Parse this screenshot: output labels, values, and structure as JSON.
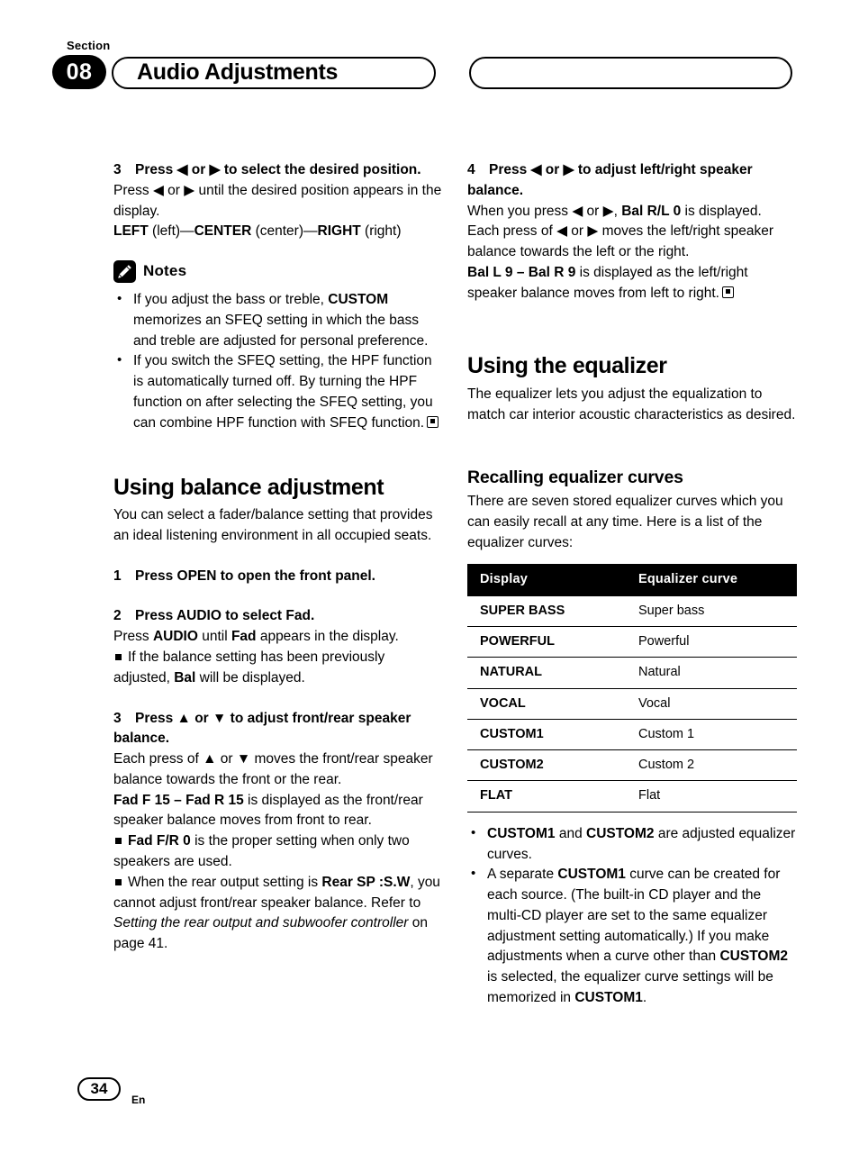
{
  "header": {
    "section_label": "Section",
    "section_number": "08",
    "title": "Audio Adjustments"
  },
  "left_column": {
    "step3": {
      "num": "3",
      "heading_pre": "Press ",
      "heading_mid": " or ",
      "heading_post": " to select the desired position.",
      "body_pre": "Press ",
      "body_mid": " or ",
      "body_post": " until the desired position appears in the display.",
      "positions_left_bold": "LEFT",
      "positions_left_plain": " (left)—",
      "positions_center_bold": "CENTER",
      "positions_center_plain": " (center)—",
      "positions_right_bold": "RIGHT",
      "positions_right_plain": " (right)"
    },
    "notes_label": "Notes",
    "notes": [
      {
        "pre": "If you adjust the bass or treble, ",
        "bold": "CUSTOM",
        "post": " memorizes an SFEQ setting in which the bass and treble are adjusted for personal preference."
      },
      {
        "pre": "If you switch the SFEQ setting, the HPF function is automatically turned off. By turning the HPF function on after selecting the SFEQ setting, you can combine HPF function with SFEQ function.",
        "bold": "",
        "post": ""
      }
    ],
    "balance_heading": "Using balance adjustment",
    "balance_intro": "You can select a fader/balance setting that provides an ideal listening environment in all occupied seats.",
    "step1": {
      "num": "1",
      "text": "Press OPEN to open the front panel."
    },
    "step2": {
      "num": "2",
      "text": "Press AUDIO to select Fad.",
      "body_pre": "Press ",
      "body_bold1": "AUDIO",
      "body_mid": " until ",
      "body_bold2": "Fad",
      "body_post": " appears in the display.",
      "note_pre": "If the balance setting has been previously adjusted, ",
      "note_bold": "Bal",
      "note_post": " will be displayed."
    },
    "step3b": {
      "num": "3",
      "heading_pre": "Press ",
      "heading_mid": " or ",
      "heading_post": " to adjust front/rear speaker balance.",
      "body_pre": "Each press of ",
      "body_mid": " or ",
      "body_post": " moves the front/rear speaker balance towards the front or the rear.",
      "range_bold": "Fad F 15 – Fad R 15",
      "range_plain": " is displayed as the front/rear speaker balance moves from front to rear.",
      "note1_bold": "Fad F/R 0",
      "note1_plain": " is the proper setting when only two speakers are used.",
      "note2_pre": "When the rear output setting is ",
      "note2_bold": "Rear SP :S.W",
      "note2_mid": ", you cannot adjust front/rear speaker balance. Refer to ",
      "note2_italic": "Setting the rear output and subwoofer controller",
      "note2_post": " on page 41."
    }
  },
  "right_column": {
    "step4": {
      "num": "4",
      "heading_pre": "Press ",
      "heading_mid": " or ",
      "heading_post": " to adjust left/right speaker balance.",
      "body_pre": "When you press ",
      "body_mid": " or ",
      "body_mid2": ", ",
      "body_bold": "Bal R/L 0",
      "body_post": " is displayed. Each press of ",
      "body_post2": " or ",
      "body_post3": " moves the left/right speaker balance towards the left or the right.",
      "range_bold": "Bal L 9 – Bal R 9",
      "range_plain": " is displayed as the left/right speaker balance moves from left to right."
    },
    "equalizer_heading": "Using the equalizer",
    "equalizer_intro": "The equalizer lets you adjust the equalization to match car interior acoustic characteristics as desired.",
    "recall_heading": "Recalling equalizer curves",
    "recall_intro": "There are seven stored equalizer curves which you can easily recall at any time. Here is a list of the equalizer curves:",
    "table": {
      "columns": [
        "Display",
        "Equalizer curve"
      ],
      "rows": [
        [
          "SUPER BASS",
          "Super bass"
        ],
        [
          "POWERFUL",
          "Powerful"
        ],
        [
          "NATURAL",
          "Natural"
        ],
        [
          "VOCAL",
          "Vocal"
        ],
        [
          "CUSTOM1",
          "Custom 1"
        ],
        [
          "CUSTOM2",
          "Custom 2"
        ],
        [
          "FLAT",
          "Flat"
        ]
      ]
    },
    "notes": [
      {
        "bold1": "CUSTOM1",
        "mid": " and ",
        "bold2": "CUSTOM2",
        "post": " are adjusted equalizer curves."
      },
      {
        "pre": "A separate ",
        "bold1": "CUSTOM1",
        "mid": " curve can be created for each source. (The built-in CD player and the multi-CD player are set to the same equalizer adjustment setting automatically.) If you make adjustments when a curve other than ",
        "bold2": "CUSTOM2",
        "mid2": " is selected, the equalizer curve settings will be memorized in ",
        "bold3": "CUSTOM1",
        "post": "."
      }
    ]
  },
  "footer": {
    "page_number": "34",
    "language": "En"
  },
  "glyphs": {
    "left_triangle": "◀",
    "right_triangle": "▶",
    "up_triangle": "▲",
    "down_triangle": "▼"
  }
}
